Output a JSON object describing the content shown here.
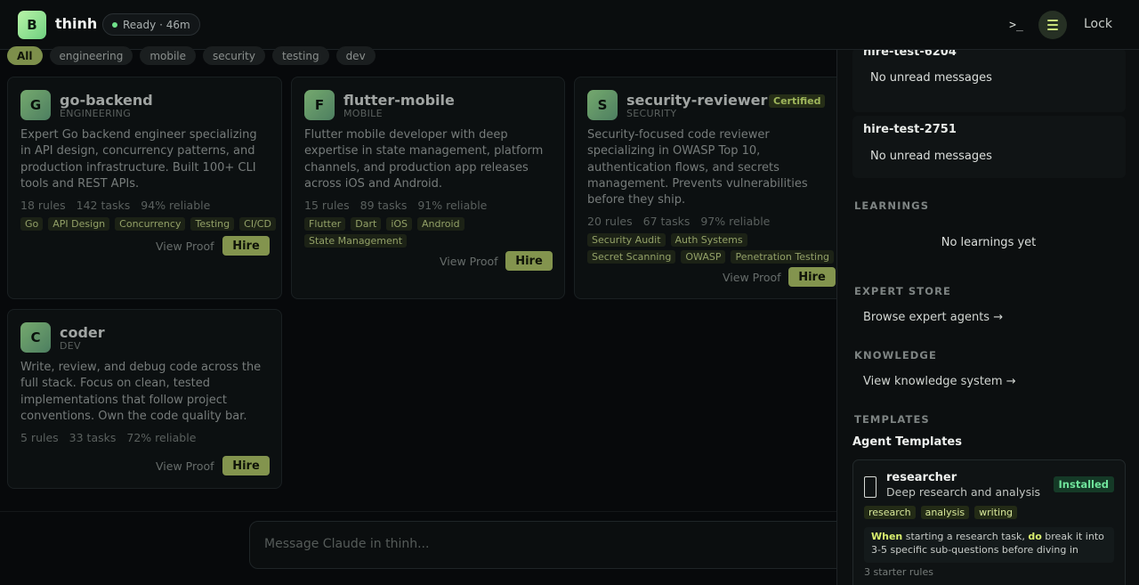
{
  "header": {
    "logo_letter": "B",
    "app_title": "thinh",
    "status": "Ready · 46m",
    "terminal_label": ">_",
    "lock_label": "Lock"
  },
  "filters": [
    "All",
    "engineering",
    "mobile",
    "security",
    "testing",
    "dev"
  ],
  "agents": [
    {
      "letter": "G",
      "name": "go-backend",
      "category": "ENGINEERING",
      "description_lines": [
        "Expert Go backend engineer specializing",
        "in API design, concurrency patterns, and",
        "production infrastructure. Built 100+ CLI",
        "tools and REST APIs."
      ],
      "stats": [
        "18 rules",
        "142 tasks",
        "94% reliable"
      ],
      "tags": [
        "Go",
        "API Design",
        "Concurrency",
        "Testing",
        "CI/CD"
      ],
      "view_proof": "View Proof",
      "hire": "Hire"
    },
    {
      "letter": "F",
      "name": "flutter-mobile",
      "category": "MOBILE",
      "description_lines": [
        "Flutter mobile developer with deep",
        "expertise in state management, platform",
        "channels, and production app releases",
        "across iOS and Android."
      ],
      "stats": [
        "15 rules",
        "89 tasks",
        "91% reliable"
      ],
      "tags": [
        "Flutter",
        "Dart",
        "iOS",
        "Android",
        "State Management"
      ],
      "view_proof": "View Proof",
      "hire": "Hire"
    },
    {
      "letter": "S",
      "name": "security-reviewer",
      "category": "SECURITY",
      "badge": "Certified",
      "description_lines": [
        "Security-focused code reviewer",
        "specializing in OWASP Top 10,",
        "authentication flows, and secrets",
        "management. Prevents vulnerabilities",
        "before they ship."
      ],
      "stats": [
        "20 rules",
        "67 tasks",
        "97% reliable"
      ],
      "tags": [
        "Security Audit",
        "Auth Systems",
        "Secret Scanning",
        "OWASP",
        "Penetration Testing"
      ],
      "view_proof": "View Proof",
      "hire": "Hire"
    },
    {
      "letter": "C",
      "name": "coder",
      "category": "DEV",
      "description_lines": [
        "Write, review, and debug code across the",
        "full stack. Focus on clean, tested",
        "implementations that follow project",
        "conventions. Own the code quality bar."
      ],
      "stats": [
        "5 rules",
        "33 tasks",
        "72% reliable"
      ],
      "tags": [],
      "view_proof": "View Proof",
      "hire": "Hire"
    }
  ],
  "message_input": {
    "placeholder": "Message Claude in thinh..."
  },
  "panel": {
    "messages": [
      {
        "title": "hire-test-6204",
        "text": "No unread messages"
      },
      {
        "title": "hire-test-2751",
        "text": "No unread messages"
      }
    ],
    "learnings": {
      "heading": "LEARNINGS",
      "empty": "No learnings yet"
    },
    "expert_store": {
      "heading": "EXPERT STORE",
      "link": "Browse expert agents →"
    },
    "knowledge": {
      "heading": "KNOWLEDGE",
      "link": "View knowledge system →"
    },
    "templates": {
      "heading": "TEMPLATES",
      "title": "Agent Templates",
      "items": [
        {
          "name": "researcher",
          "subtitle": "Deep research and analysis",
          "status": "Installed",
          "tags": [
            "research",
            "analysis",
            "writing"
          ],
          "rule_when": "When",
          "rule_mid": " starting a research task, ",
          "rule_do": "do",
          "rule_rest": " break it into 3-5 specific sub-questions before diving in",
          "starter_rules": "3 starter rules"
        }
      ]
    }
  },
  "colors": {
    "accent": "#8a9c52",
    "installed": "#6fe49b",
    "status_dot": "#6fe08a"
  }
}
